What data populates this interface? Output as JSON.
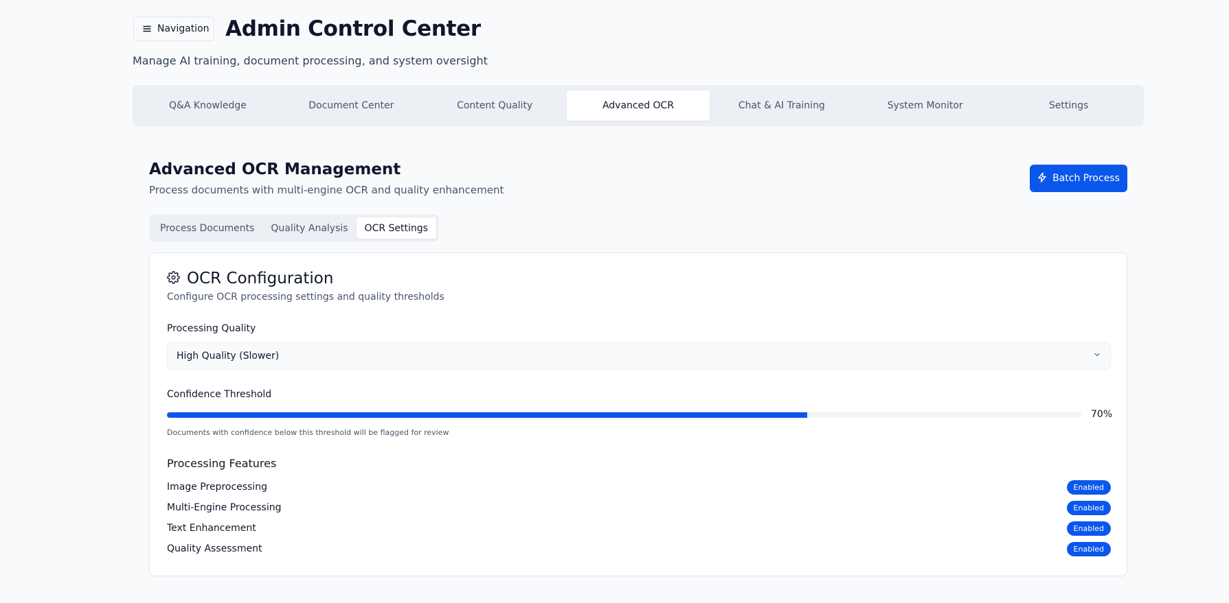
{
  "header": {
    "nav_button_label": "Navigation",
    "nav_button_icon": "menu-icon",
    "title": "Admin Control Center",
    "subtitle": "Manage AI training, document processing, and system oversight"
  },
  "main_tabs": [
    {
      "label": "Q&A Knowledge",
      "active": false
    },
    {
      "label": "Document Center",
      "active": false
    },
    {
      "label": "Content Quality",
      "active": false
    },
    {
      "label": "Advanced OCR",
      "active": true
    },
    {
      "label": "Chat & AI Training",
      "active": false
    },
    {
      "label": "System Monitor",
      "active": false
    },
    {
      "label": "Settings",
      "active": false
    }
  ],
  "section": {
    "title": "Advanced OCR Management",
    "subtitle": "Process documents with multi-engine OCR and quality enhancement",
    "batch_button_label": "Batch Process",
    "batch_button_icon": "lightning-icon"
  },
  "sub_tabs": [
    {
      "label": "Process Documents",
      "active": false
    },
    {
      "label": "Quality Analysis",
      "active": false
    },
    {
      "label": "OCR Settings",
      "active": true
    }
  ],
  "config": {
    "icon": "gear-icon",
    "title": "OCR Configuration",
    "description": "Configure OCR processing settings and quality thresholds",
    "quality_label": "Processing Quality",
    "quality_value": "High Quality (Slower)",
    "threshold_label": "Confidence Threshold",
    "threshold_percent": 70,
    "threshold_display": "70%",
    "threshold_hint": "Documents with confidence below this threshold will be flagged for review",
    "features_heading": "Processing Features",
    "features": [
      {
        "name": "Image Preprocessing",
        "status": "Enabled"
      },
      {
        "name": "Multi-Engine Processing",
        "status": "Enabled"
      },
      {
        "name": "Text Enhancement",
        "status": "Enabled"
      },
      {
        "name": "Quality Assessment",
        "status": "Enabled"
      }
    ]
  },
  "colors": {
    "accent": "#0b57ec",
    "background": "#f8fafc",
    "tab_bar": "#eceff3"
  }
}
